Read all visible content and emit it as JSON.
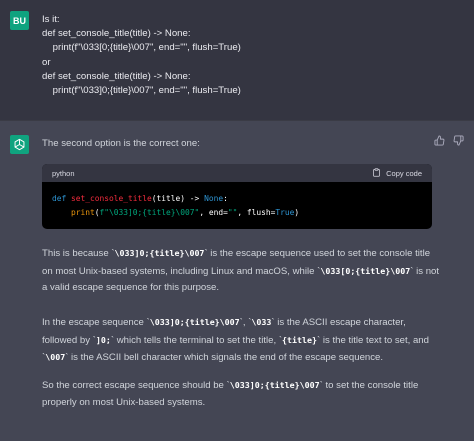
{
  "user": {
    "avatar_label": "BU",
    "lines": [
      "Is it:",
      "def set_console_title(title) -> None:",
      "    print(f\"\\033[0;{title}\\007\", end=\"\", flush=True)",
      "or",
      "def set_console_title(title) -> None:",
      "    print(f\"\\033]0;{title}\\007\", end=\"\", flush=True)"
    ]
  },
  "assistant": {
    "avatar_icon": "openai-logo-icon",
    "intro": "The second option is the correct one:",
    "code_block": {
      "language": "python",
      "copy_label": "Copy code",
      "line1": {
        "def": "def",
        "fn": "set_console_title",
        "rest": "(title) -> ",
        "none": "None",
        "colon": ":"
      },
      "line2": {
        "indent": "    ",
        "print": "print",
        "open": "(",
        "fstring": "f\"\\033]0;{title}\\007\"",
        "mid": ", end=",
        "empty": "\"\"",
        "flush": ", flush=",
        "true": "True",
        "close": ")"
      }
    },
    "para1": {
      "t1": "This is because `",
      "c1": "\\033]0;{title}\\007",
      "t2": "` is the escape sequence used to set the console title on most Unix-based systems, including Linux and macOS, while `",
      "c2": "\\033[0;{title}\\007",
      "t3": "` is not a valid escape sequence for this purpose."
    },
    "para2": {
      "t1": "In the escape sequence `",
      "c1": "\\033]0;{title}\\007",
      "t2": "`, `",
      "c2": "\\033",
      "t3": "` is the ASCII escape character, followed by `",
      "c3": "]0;",
      "t4": "` which tells the terminal to set the title, `",
      "c4": "{title}",
      "t5": "` is the title text to set, and `",
      "c5": "\\007",
      "t6": "` is the ASCII bell character which signals the end of the escape sequence."
    },
    "para3": {
      "t1": "So the correct escape sequence should be `",
      "c1": "\\033]0;{title}\\007",
      "t2": "` to set the console title properly on most Unix-based systems."
    },
    "feedback": {
      "up_icon": "thumbs-up-icon",
      "down_icon": "thumbs-down-icon"
    }
  },
  "colors": {
    "user_bg": "#343541",
    "assistant_bg": "#444654",
    "avatar_green": "#10a37f",
    "code_bg": "#000000",
    "code_header_bg": "#343541"
  }
}
